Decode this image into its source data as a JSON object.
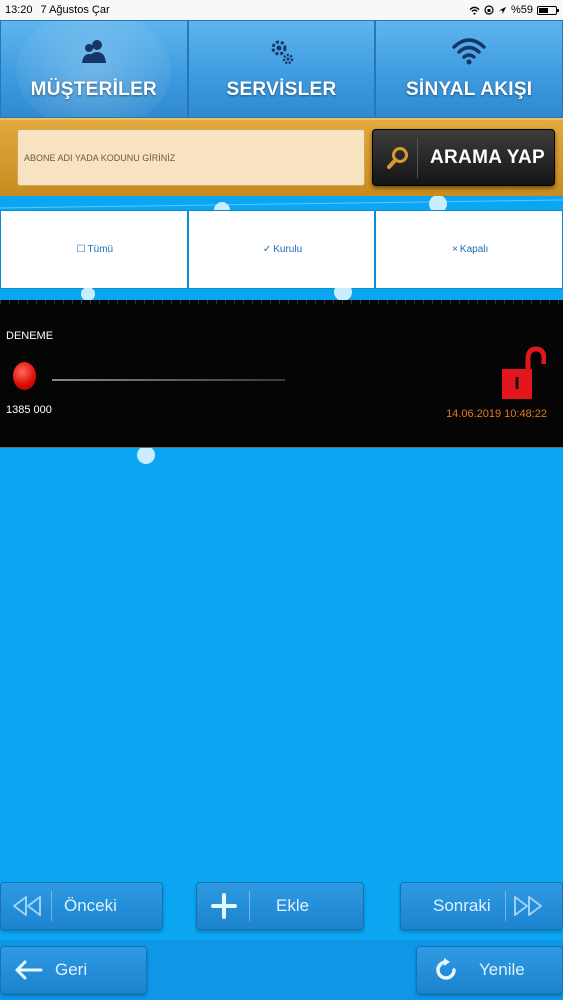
{
  "status_bar": {
    "time": "13:20",
    "date": "7 Ağustos Çar",
    "battery": "%59",
    "battery_level": 0.59
  },
  "tabs": [
    {
      "label": "MÜŞTERİLER",
      "icon": "users-icon",
      "active": true
    },
    {
      "label": "SERVİSLER",
      "icon": "gears-icon",
      "active": false
    },
    {
      "label": "SİNYAL AKIŞI",
      "icon": "wifi-icon",
      "active": false
    }
  ],
  "search": {
    "placeholder": "ABONE ADI YADA KODUNU GİRİNİZ",
    "value": "",
    "button_label": "ARAMA YAP"
  },
  "filters": [
    {
      "symbol": "☐",
      "label": "Tümü"
    },
    {
      "symbol": "✓",
      "label": "Kurulu"
    },
    {
      "symbol": "×",
      "label": "Kapalı"
    }
  ],
  "records": [
    {
      "name": "DENEME",
      "code": "1385 000",
      "timestamp": "14.06.2019 10:48:22",
      "status_color": "#e00f05",
      "lock_state": "unlocked",
      "lock_icon": "unlocked-padlock-icon"
    }
  ],
  "pager": {
    "prev_label": "Önceki",
    "add_label": "Ekle",
    "next_label": "Sonraki"
  },
  "footer": {
    "back_label": "Geri",
    "refresh_label": "Yenile"
  },
  "colors": {
    "background": "#0aa6f2",
    "accent_gold": "#d69a2e",
    "record_date": "#e07a1e",
    "lock_red": "#e3161b"
  }
}
